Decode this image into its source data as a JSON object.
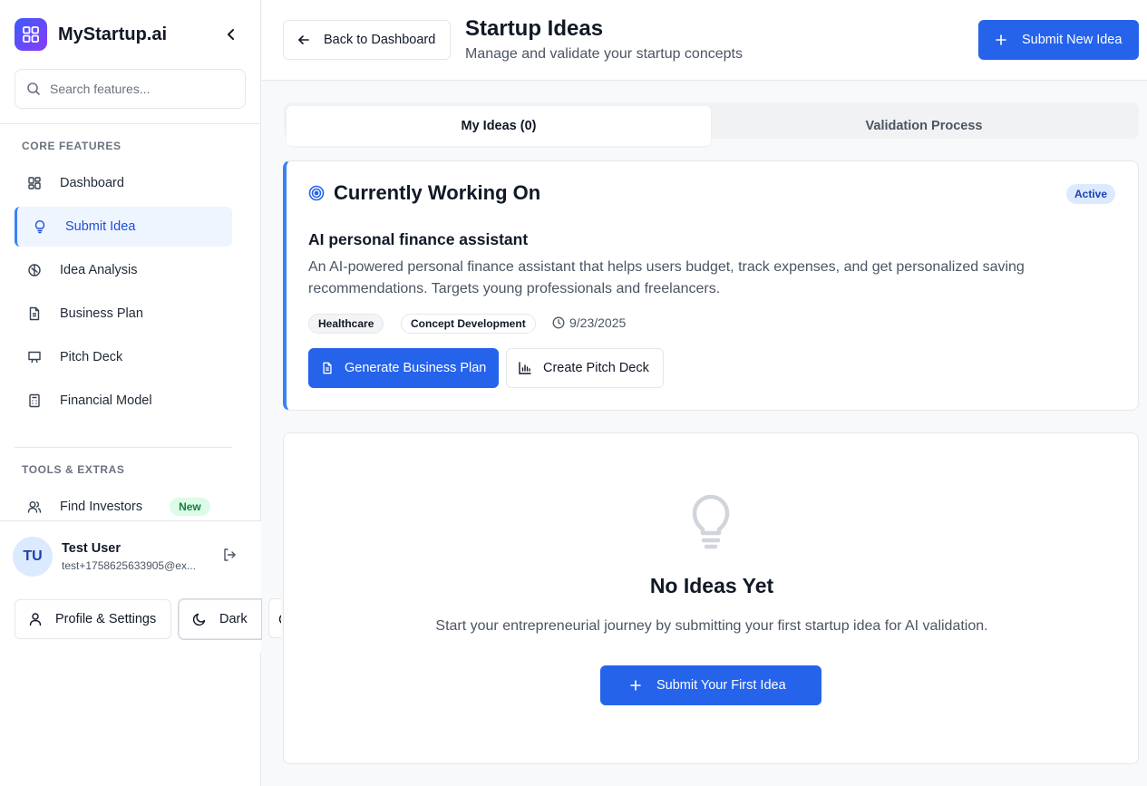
{
  "app": {
    "name": "MyStartup.ai"
  },
  "search": {
    "placeholder": "Search features..."
  },
  "sidebar": {
    "core_label": "CORE FEATURES",
    "core_items": [
      {
        "label": "Dashboard",
        "icon": "grid-icon"
      },
      {
        "label": "Submit Idea",
        "icon": "lightbulb-icon",
        "active": true
      },
      {
        "label": "Idea Analysis",
        "icon": "brain-icon"
      },
      {
        "label": "Business Plan",
        "icon": "document-icon"
      },
      {
        "label": "Pitch Deck",
        "icon": "presentation-icon"
      },
      {
        "label": "Financial Model",
        "icon": "calculator-icon"
      }
    ],
    "tools_label": "TOOLS & EXTRAS",
    "tools_items": [
      {
        "label": "Find Investors",
        "icon": "users-icon",
        "badge": "New"
      }
    ]
  },
  "user": {
    "initials": "TU",
    "name": "Test User",
    "email": "test+1758625633905@ex..."
  },
  "footer_buttons": {
    "profile": "Profile & Settings",
    "theme": "Dark"
  },
  "header": {
    "back_label": "Back to Dashboard",
    "title": "Startup Ideas",
    "subtitle": "Manage and validate your startup concepts",
    "submit_new_label": "Submit New Idea"
  },
  "tabs": [
    {
      "label": "My Ideas (0)",
      "active": true
    },
    {
      "label": "Validation Process",
      "active": false
    }
  ],
  "current": {
    "heading": "Currently Working On",
    "status": "Active",
    "idea_title": "AI personal finance assistant",
    "idea_description": "An AI-powered personal finance assistant that helps users budget, track expenses, and get personalized saving recommendations. Targets young professionals and freelancers.",
    "tags": [
      "Healthcare",
      "Concept Development"
    ],
    "date": "9/23/2025",
    "generate_label": "Generate Business Plan",
    "pitch_label": "Create Pitch Deck"
  },
  "empty": {
    "title": "No Ideas Yet",
    "description": "Start your entrepreneurial journey by submitting your first startup idea for AI validation.",
    "button_label": "Submit Your First Idea"
  },
  "colors": {
    "primary": "#2563eb",
    "accent_border": "#3b82f6",
    "new_badge": "#dcfce7"
  }
}
